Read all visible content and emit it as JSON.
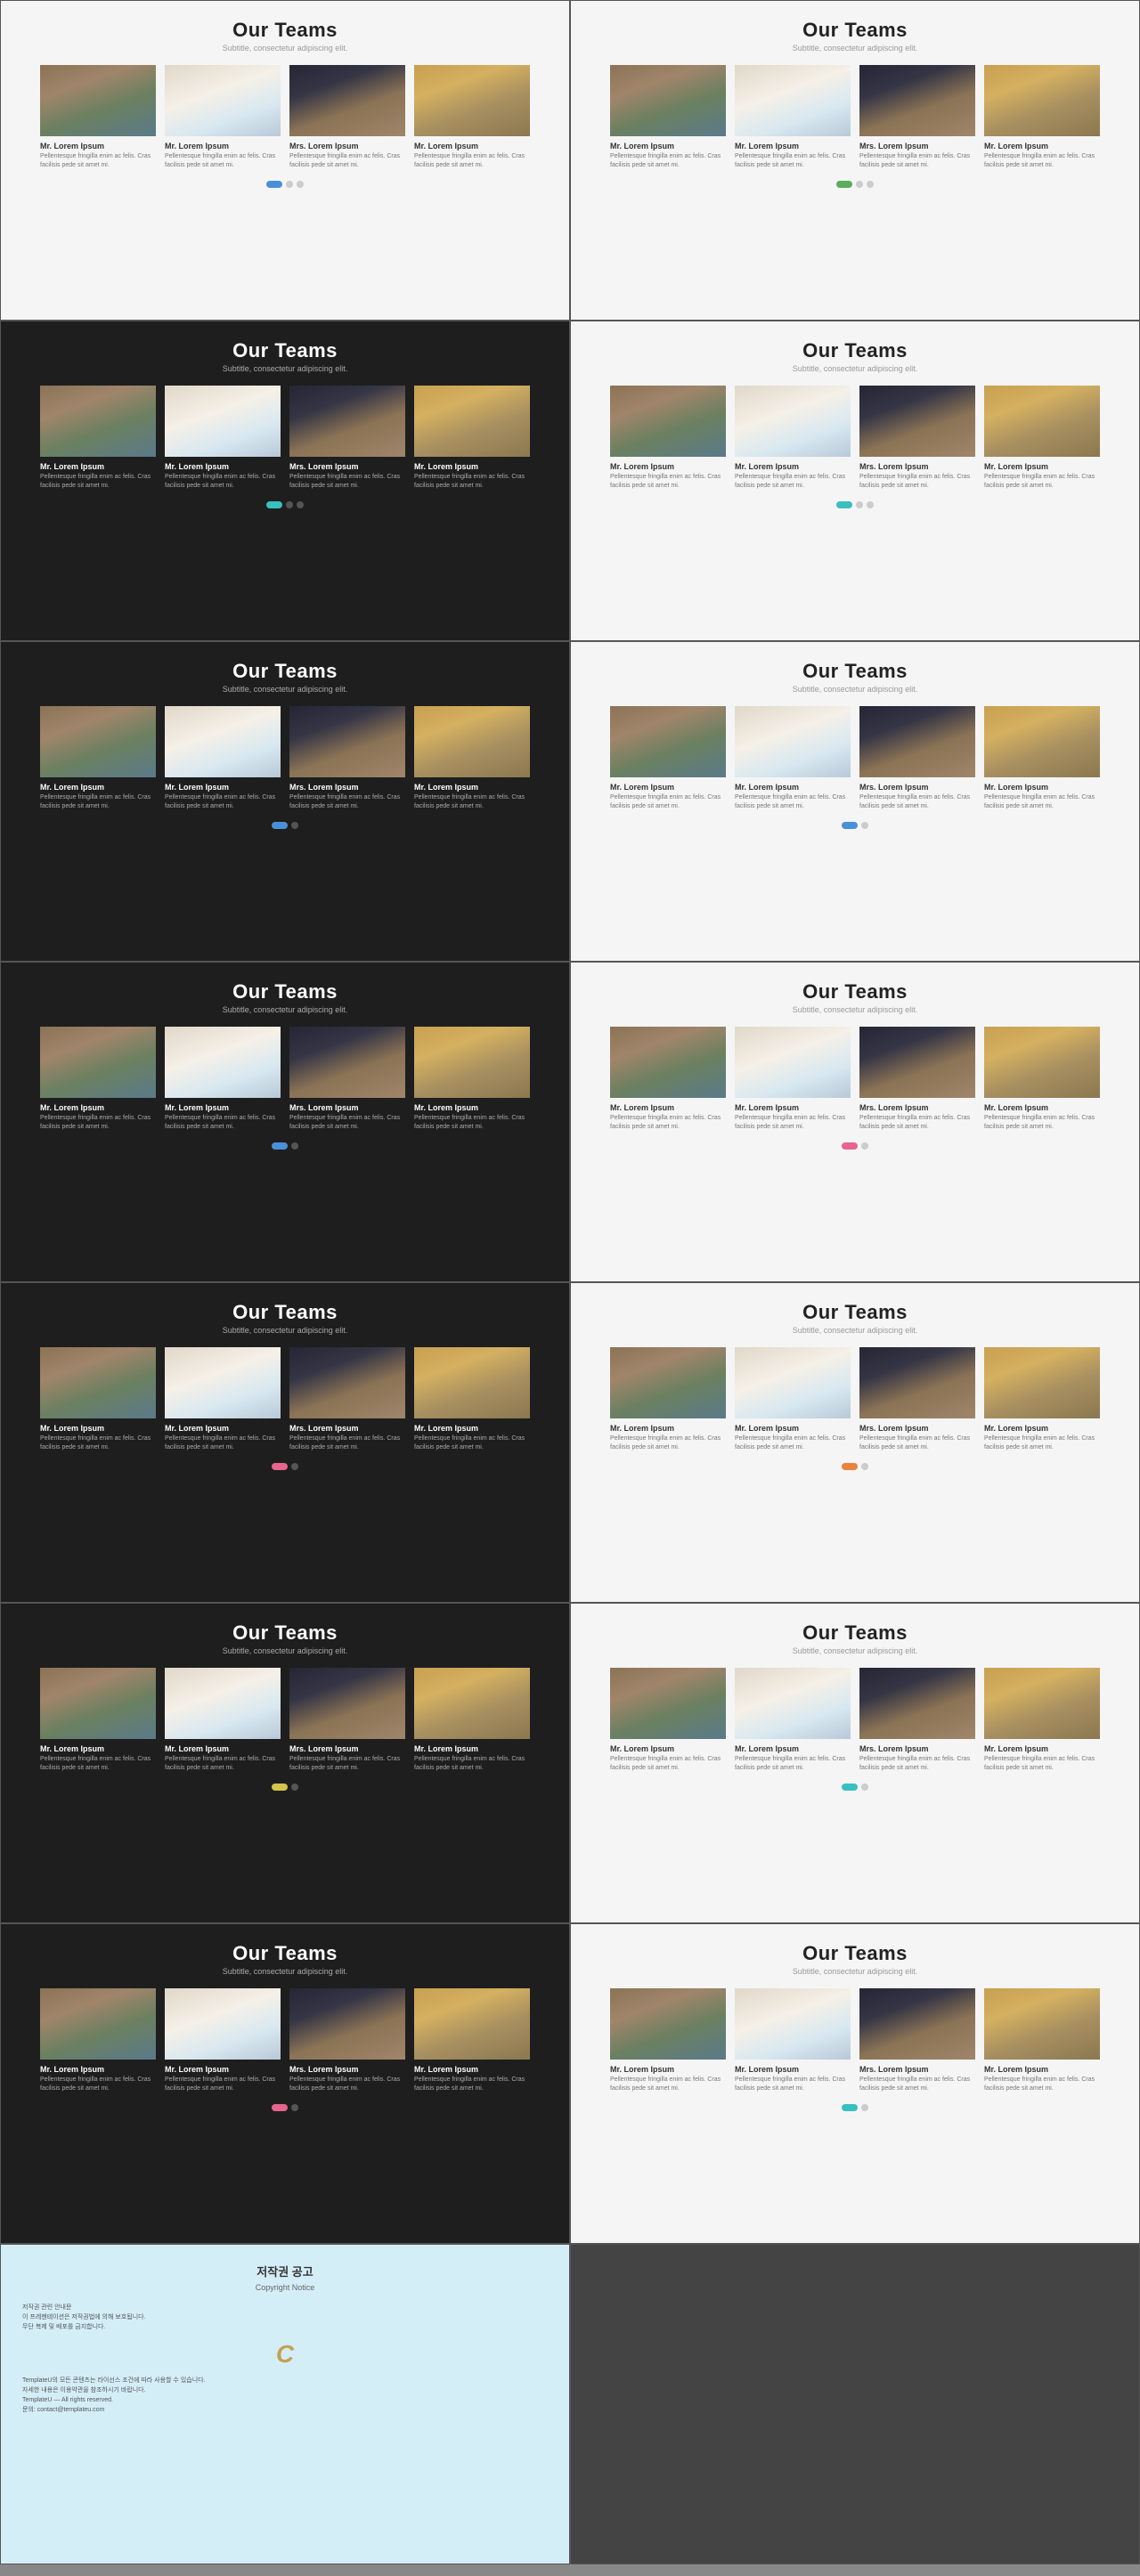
{
  "slides": [
    {
      "theme": "light",
      "indicator": "blue"
    },
    {
      "theme": "light",
      "indicator": "green"
    },
    {
      "theme": "dark",
      "indicator": "teal"
    },
    {
      "theme": "light",
      "indicator": "teal"
    },
    {
      "theme": "dark",
      "indicator": "blue"
    },
    {
      "theme": "light",
      "indicator": "blue"
    },
    {
      "theme": "dark",
      "indicator": "blue"
    },
    {
      "theme": "light",
      "indicator": "pink"
    },
    {
      "theme": "dark",
      "indicator": "pink"
    },
    {
      "theme": "light",
      "indicator": "orange"
    },
    {
      "theme": "dark",
      "indicator": "yellow"
    },
    {
      "theme": "light",
      "indicator": "teal"
    },
    {
      "theme": "dark",
      "indicator": "pink"
    },
    {
      "theme": "light",
      "indicator": "teal"
    }
  ],
  "title": "Our Teams",
  "subtitle": "Subtitle, consectetur adipiscing elit.",
  "members": [
    {
      "name": "Mr. Lorem Ipsum",
      "desc": "Pellentesque fringilla enim ac felis. Cras facilisis pede sit amet mi."
    },
    {
      "name": "Mr. Lorem Ipsum",
      "desc": "Pellentesque fringilla enim ac felis. Cras facilisis pede sit amet mi."
    },
    {
      "name": "Mrs. Lorem Ipsum",
      "desc": "Pellentesque fringilla enim ac felis. Cras facilisis pede sit amet mi."
    },
    {
      "name": "Mr. Lorem Ipsum",
      "desc": "Pellentesque fringilla enim ac felis. Cras facilisis pede sit amet mi."
    }
  ],
  "footer": {
    "title": "저작권 공고",
    "copy": "Copyright Notice",
    "texts": [
      "저작권 관련 안내문",
      "이 프레젠테이션은 저작권법에 의해 보호됩니다.",
      "무단 복제 및 배포를 금지합니다.",
      "TemplateU의 모든 콘텐츠는 라이선스 조건에 따라 사용할 수 있습니다.",
      "자세한 내용은 이용약관을 참조하시기 바랍니다.",
      "TemplateU — All rights reserved.",
      "문의: contact@templateu.com"
    ],
    "logo": "C"
  }
}
